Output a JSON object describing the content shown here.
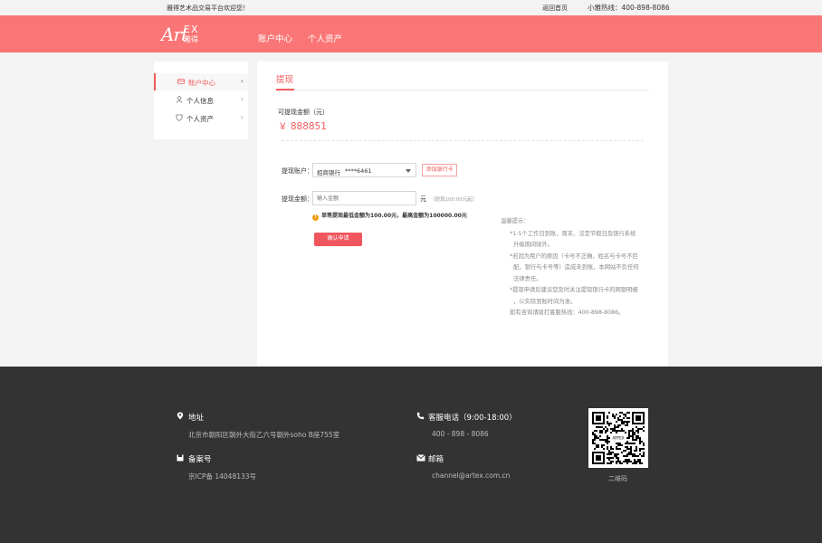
{
  "topbar": {
    "welcome": "雅得艺术品交易平台欢迎您！",
    "home_link": "返回首页",
    "hotline": "小雅热线：400-898-8086"
  },
  "header": {
    "logo_art": "Art",
    "logo_ex": "EX",
    "logo_cn": "雅得",
    "nav": [
      "账户中心",
      "个人资产"
    ]
  },
  "sidebar": {
    "items": [
      {
        "label": "账户中心",
        "icon": "account-icon",
        "active": true
      },
      {
        "label": "个人信息",
        "icon": "user-icon",
        "active": false
      },
      {
        "label": "个人资产",
        "icon": "asset-icon",
        "active": false
      }
    ]
  },
  "withdraw": {
    "title": "提现",
    "available_label": "可提现金额（元）",
    "available_value": "￥ 888851",
    "account_label": "提现账户：",
    "bank_name": "招商银行",
    "card_no": "****6461",
    "add_card": "添加银行卡",
    "amount_label": "提现金额：",
    "amount_placeholder": "输入金额",
    "unit": "元",
    "amount_hint": "（提现100.00元起）",
    "warning": "单笔提现最低金额为100.00元，最高金额为100000.00元",
    "confirm": "确认申请"
  },
  "tips": {
    "title": "温馨提示：",
    "items": [
      "*1-5个工作日到账，周末、法定节假日及银行系统",
      "升级期间除外。",
      "*若因为用户的原因（卡号不正确，姓名与卡号不匹",
      "配，银行与卡号等）造成未到账，本网站不负任何",
      "法律责任。",
      "*提现申请后建议您及时关注提现银行卡的网银明细",
      "，以实际到账时间为准。",
      "如有咨询请拨打客服热线：400-898-8086。"
    ]
  },
  "footer": {
    "address_title": "地址",
    "address": "北京市朝阳区朝外大街乙六号朝外soho B座755室",
    "record_title": "备案号",
    "record": "京ICP备 14048133号",
    "phone_title": "客服电话（9:00-18:00）",
    "phone": "400 - 898 - 8086",
    "email_title": "邮箱",
    "email": "channel@artex.com.cn",
    "qr_label": "二维码",
    "qr_center": "ARTEX"
  },
  "colors": {
    "brand": "#fa7676",
    "accent": "#f05a5a",
    "footer_bg": "#333333"
  }
}
